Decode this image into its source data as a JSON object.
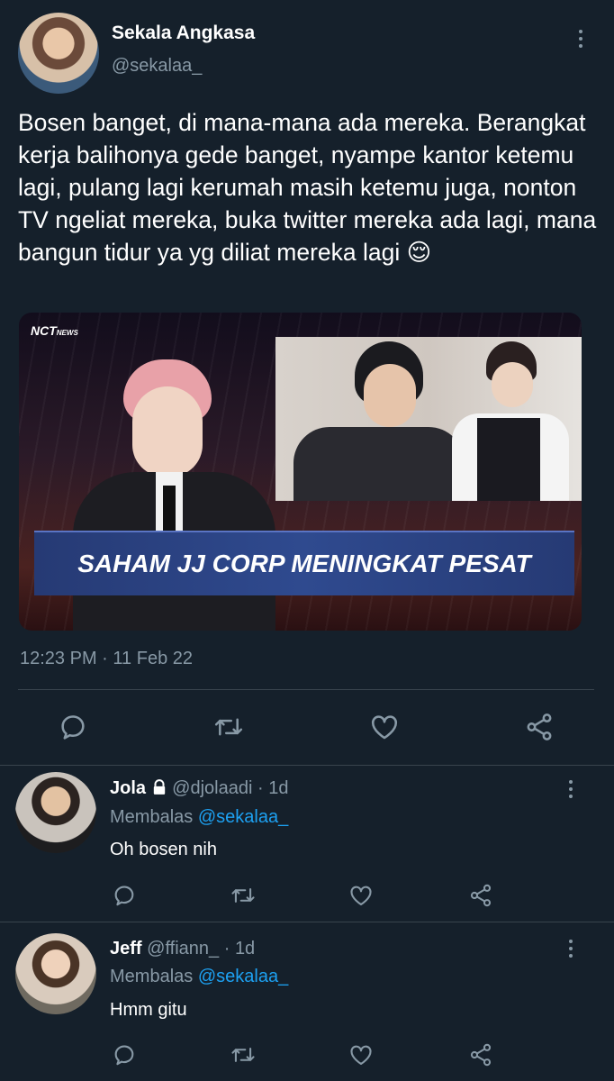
{
  "colors": {
    "background": "#15202b",
    "muted": "#8899a6",
    "link": "#1da1f2",
    "divider": "#38444d",
    "banner": "#2a3f7a"
  },
  "tweet": {
    "author_name": "Sekala Angkasa",
    "author_handle": "@sekalaa_",
    "text": "Bosen banget, di mana-mana ada mereka. Berangkat kerja balihonya gede banget, nyampe kantor ketemu lagi, pulang lagi kerumah masih ketemu juga, nonton TV ngeliat mereka, buka twitter mereka ada lagi, mana bangun tidur ya yg diliat mereka lagi",
    "emoji": "😌",
    "image": {
      "logo_brand": "NCT",
      "logo_suffix": "NEWS",
      "banner_text": "SAHAM JJ CORP MENINGKAT PESAT"
    },
    "time": "12:23 PM",
    "dot": "·",
    "date": "11 Feb 22"
  },
  "actions": [
    "reply-icon",
    "retweet-icon",
    "like-icon",
    "share-icon"
  ],
  "replies": [
    {
      "name": "Jola",
      "locked": true,
      "handle": "@djolaadi",
      "dot": "·",
      "time": "1d",
      "replying_label": "Membalas",
      "replying_to": "@sekalaa_",
      "text": "Oh bosen nih"
    },
    {
      "name": "Jeff",
      "locked": false,
      "handle": "@ffiann_",
      "dot": "·",
      "time": "1d",
      "replying_label": "Membalas",
      "replying_to": "@sekalaa_",
      "text": "Hmm gitu"
    }
  ]
}
